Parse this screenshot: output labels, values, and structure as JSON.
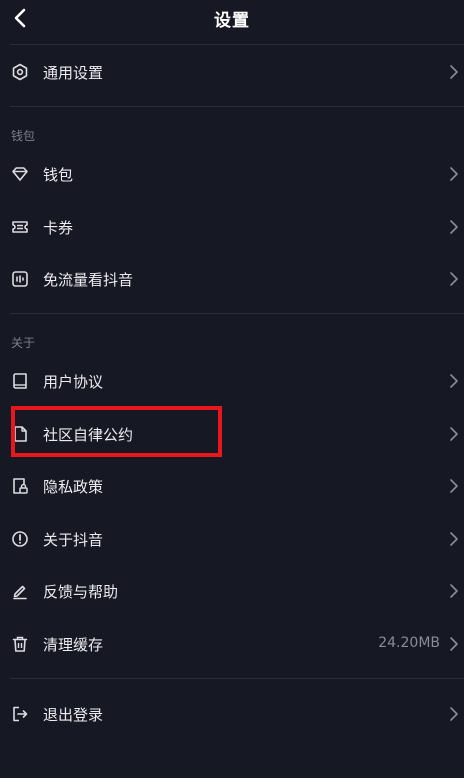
{
  "header": {
    "title": "设置"
  },
  "sections": {
    "wallet_label": "钱包",
    "about_label": "关于"
  },
  "items": {
    "general": {
      "label": "通用设置",
      "icon": "hexagon-settings-icon"
    },
    "wallet": {
      "label": "钱包",
      "icon": "diamond-icon"
    },
    "coupons": {
      "label": "卡券",
      "icon": "ticket-icon"
    },
    "free_data": {
      "label": "免流量看抖音",
      "icon": "data-free-icon"
    },
    "user_agreement": {
      "label": "用户协议",
      "icon": "book-icon"
    },
    "community": {
      "label": "社区自律公约",
      "icon": "document-icon"
    },
    "privacy": {
      "label": "隐私政策",
      "icon": "privacy-lock-icon"
    },
    "about": {
      "label": "关于抖音",
      "icon": "info-circle-icon"
    },
    "feedback": {
      "label": "反馈与帮助",
      "icon": "pencil-icon"
    },
    "cache": {
      "label": "清理缓存",
      "icon": "trash-icon",
      "value": "24.20MB"
    },
    "logout": {
      "label": "退出登录",
      "icon": "logout-icon"
    }
  },
  "colors": {
    "background": "#161823",
    "highlight": "#e8161d"
  }
}
